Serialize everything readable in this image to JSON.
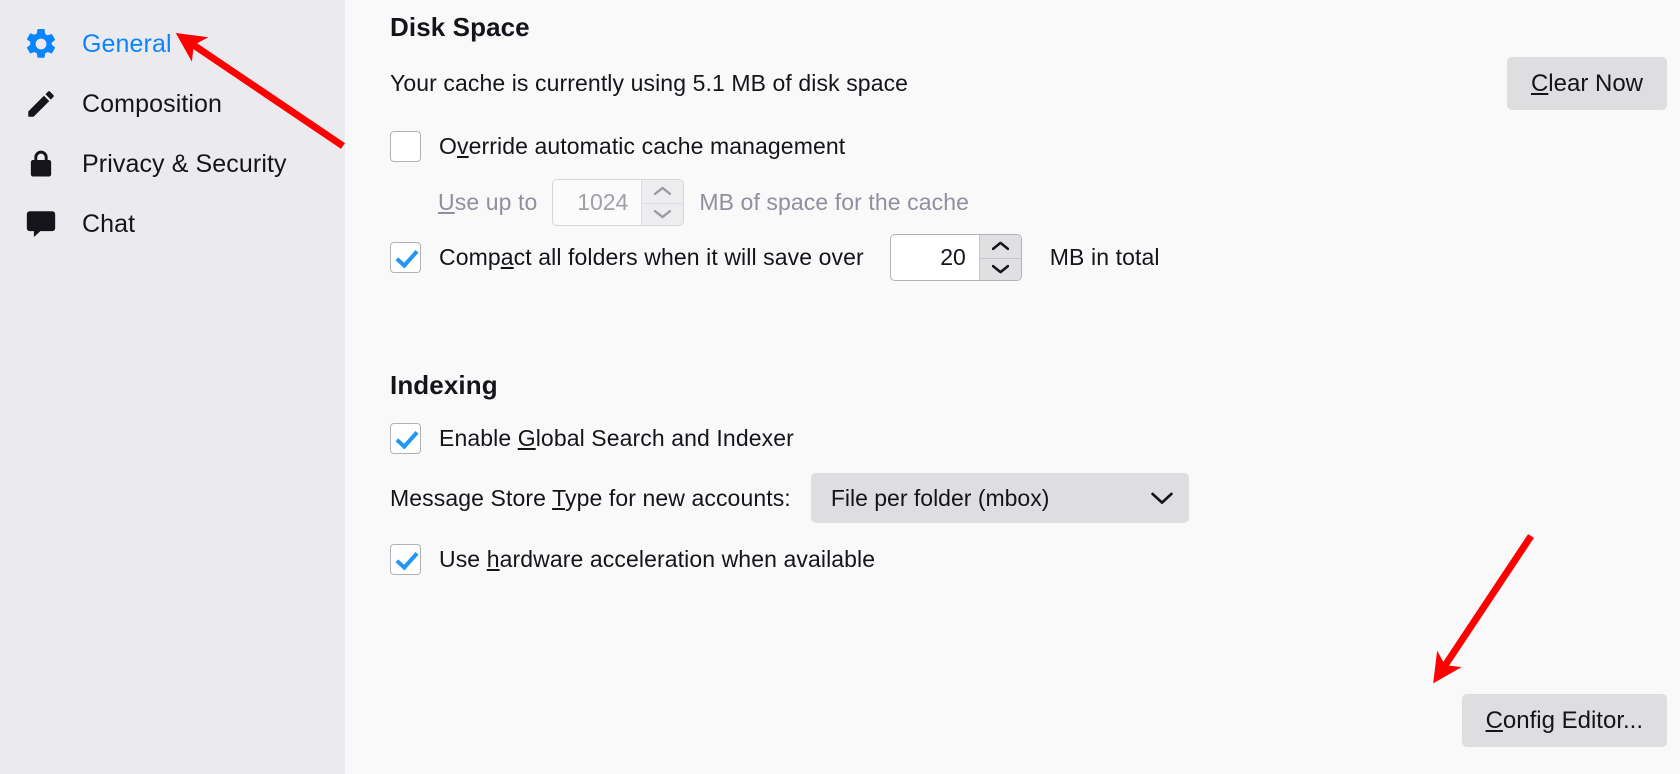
{
  "sidebar": {
    "items": [
      {
        "id": "general",
        "label": "General",
        "icon": "gear-icon",
        "selected": true
      },
      {
        "id": "composition",
        "label": "Composition",
        "icon": "pencil-icon",
        "selected": false
      },
      {
        "id": "privacy",
        "label": "Privacy & Security",
        "icon": "lock-icon",
        "selected": false
      },
      {
        "id": "chat",
        "label": "Chat",
        "icon": "chat-bubble-icon",
        "selected": false
      }
    ]
  },
  "main": {
    "disk_space": {
      "heading": "Disk Space",
      "cache_status": "Your cache is currently using 5.1 MB of disk space",
      "clear_button": "Clear Now",
      "override_checkbox": {
        "label_before": "O",
        "label_key": "v",
        "label_after": "erride automatic cache management",
        "checked": false
      },
      "use_up_to": {
        "label_key": "U",
        "label_after": "se up to",
        "value": "1024",
        "suffix": "MB of space for the cache",
        "disabled": true
      },
      "compact": {
        "label_before": "Comp",
        "label_key": "a",
        "label_after": "ct all folders when it will save over",
        "value": "20",
        "suffix": "MB in total",
        "checked": true
      }
    },
    "indexing": {
      "heading": "Indexing",
      "global_search": {
        "label_before": "Enable ",
        "label_key": "G",
        "label_after": "lobal Search and Indexer",
        "checked": true
      },
      "store_type": {
        "label_before": "Message Store ",
        "label_key": "T",
        "label_after": "ype for new accounts:",
        "selected_option": "File per folder (mbox)"
      },
      "hardware_accel": {
        "label_before": "Use ",
        "label_key": "h",
        "label_after": "ardware acceleration when available",
        "checked": true
      }
    },
    "config_editor_button": "Config Editor..."
  },
  "colors": {
    "accent_blue": "#0a84ff",
    "check_blue": "#2196f3",
    "sidebar_bg": "#ebebef",
    "content_bg": "#f9f9fa",
    "annotation_red": "#ff0000",
    "button_bg": "#dedee0",
    "text": "#15141a",
    "muted_text": "#8f8f9d"
  }
}
